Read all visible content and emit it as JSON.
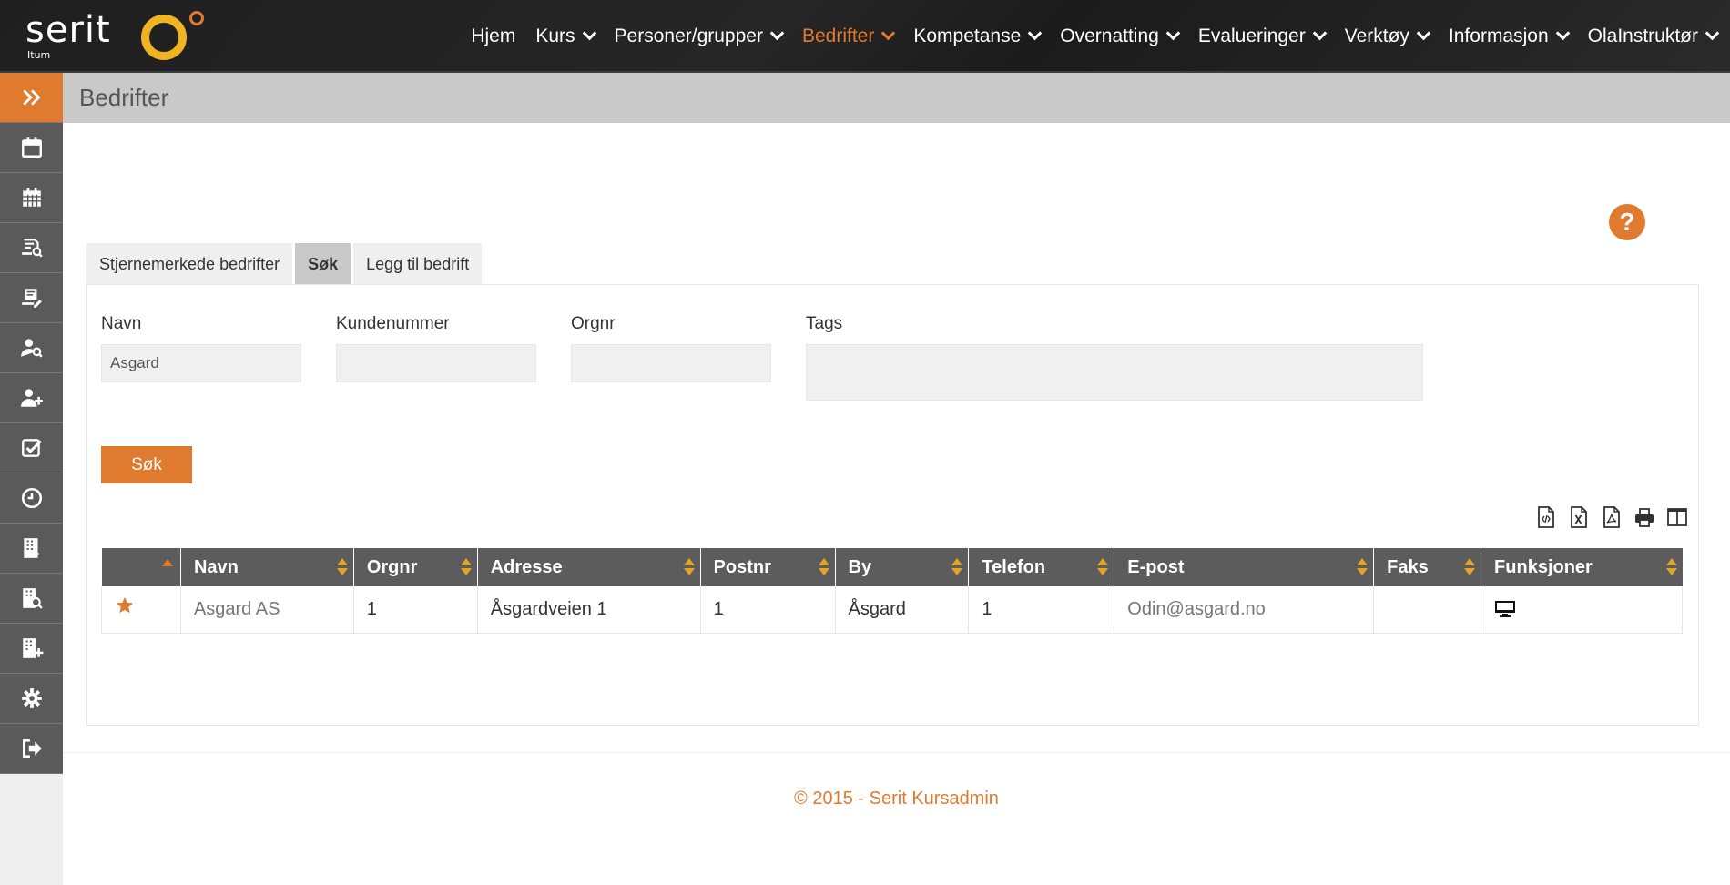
{
  "brand": {
    "name": "serit",
    "sub": "Itum",
    "ring_color": "#f0b323",
    "accent": "#e07a2e"
  },
  "nav": [
    {
      "label": "Hjem",
      "dropdown": false,
      "active": false
    },
    {
      "label": "Kurs",
      "dropdown": true,
      "active": false
    },
    {
      "label": "Personer/grupper",
      "dropdown": true,
      "active": false
    },
    {
      "label": "Bedrifter",
      "dropdown": true,
      "active": true
    },
    {
      "label": "Kompetanse",
      "dropdown": true,
      "active": false
    },
    {
      "label": "Overnatting",
      "dropdown": true,
      "active": false
    },
    {
      "label": "Evalueringer",
      "dropdown": true,
      "active": false
    },
    {
      "label": "Verktøy",
      "dropdown": true,
      "active": false
    },
    {
      "label": "Informasjon",
      "dropdown": true,
      "active": false
    },
    {
      "label": "OlaInstruktør",
      "dropdown": true,
      "active": false
    }
  ],
  "sidebar": {
    "icons": [
      "double-chevron-right-icon",
      "calendar-icon",
      "calendar-grid-icon",
      "course-search-icon",
      "course-edit-icon",
      "user-search-icon",
      "add-user-icon",
      "checklist-icon",
      "clock-icon",
      "company-icon",
      "company-search-icon",
      "add-company-icon",
      "gear-icon",
      "sign-out-icon"
    ]
  },
  "page": {
    "title": "Bedrifter"
  },
  "tabs": [
    {
      "label": "Stjernemerkede bedrifter",
      "active": false
    },
    {
      "label": "Søk",
      "active": true
    },
    {
      "label": "Legg til bedrift",
      "active": false
    }
  ],
  "form": {
    "name_label": "Navn",
    "name_value": "Asgard",
    "customer_label": "Kundenummer",
    "customer_value": "",
    "orgnr_label": "Orgnr",
    "orgnr_value": "",
    "tags_label": "Tags",
    "tags_value": "",
    "submit_label": "Søk"
  },
  "export_icons": [
    "csv-file-icon",
    "excel-file-icon",
    "pdf-file-icon",
    "print-icon",
    "columns-icon"
  ],
  "table": {
    "headers": [
      "",
      "Navn",
      "Orgnr",
      "Adresse",
      "Postnr",
      "By",
      "Telefon",
      "E-post",
      "Faks",
      "Funksjoner"
    ],
    "rows": [
      {
        "starred": true,
        "navn": "Asgard AS",
        "orgnr": "1",
        "adresse": "Åsgardveien 1",
        "postnr": "1",
        "by": "Åsgard",
        "telefon": "1",
        "epost": "Odin@asgard.no",
        "faks": ""
      }
    ]
  },
  "footer": {
    "text": "© 2015 - Serit Kursadmin"
  }
}
